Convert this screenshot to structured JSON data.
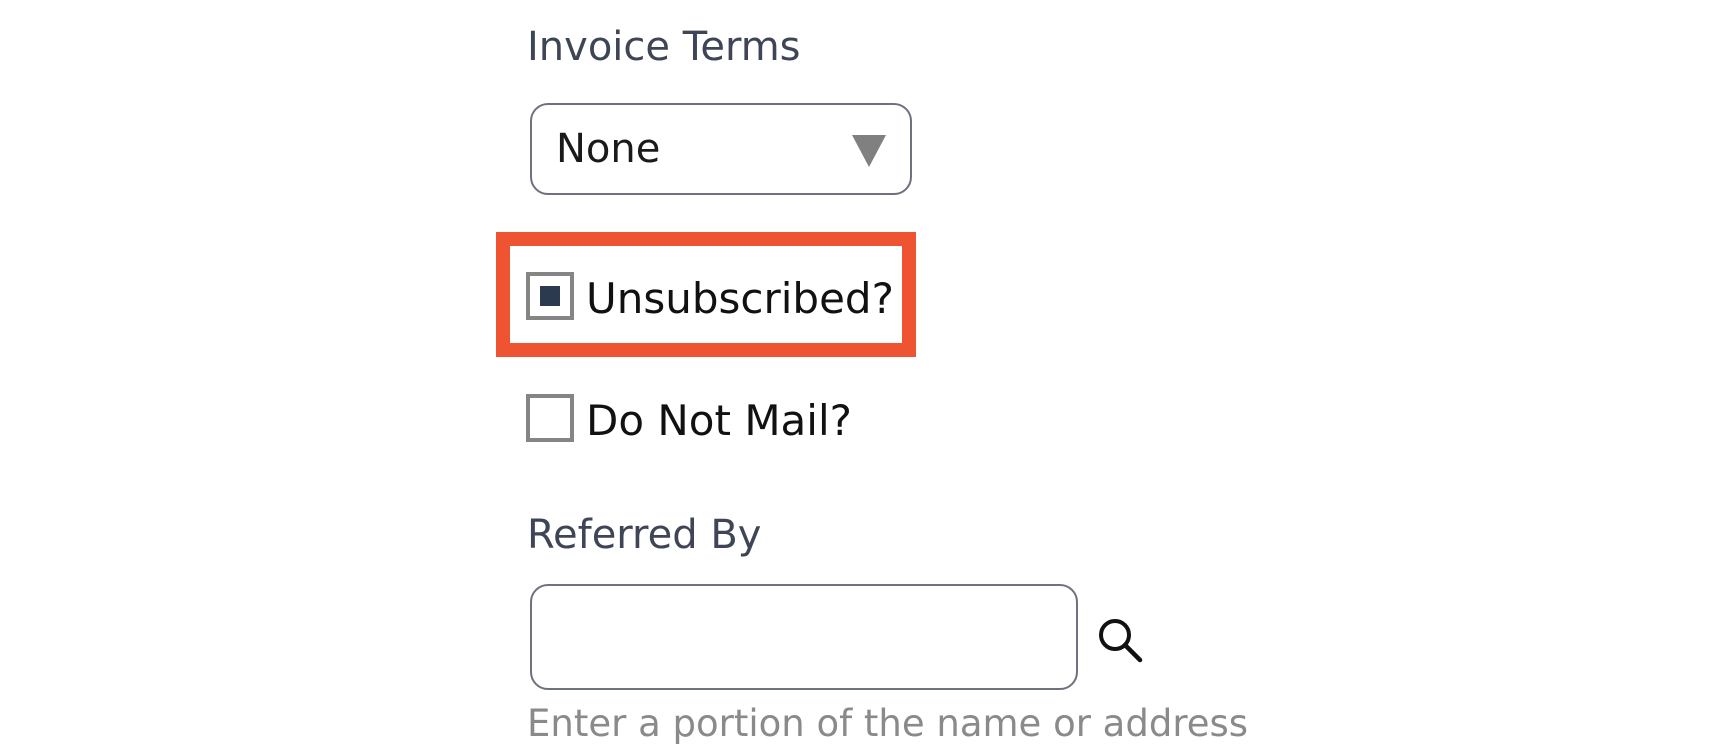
{
  "invoice_terms": {
    "label": "Invoice Terms",
    "selected_value": "None"
  },
  "unsubscribed": {
    "label": "Unsubscribed?",
    "checked": true
  },
  "do_not_mail": {
    "label": "Do Not Mail?",
    "checked": false
  },
  "referred_by": {
    "label": "Referred By",
    "value": "",
    "placeholder": "",
    "help_text": "Enter a portion of the name or address"
  },
  "colors": {
    "highlight": "#ee5431",
    "checkbox_fill": "#2c3a50",
    "label_text": "#3e4556",
    "help_text": "#8a8a8a"
  },
  "icons": {
    "select_arrow": "triangle-down-icon",
    "search": "search-icon"
  }
}
